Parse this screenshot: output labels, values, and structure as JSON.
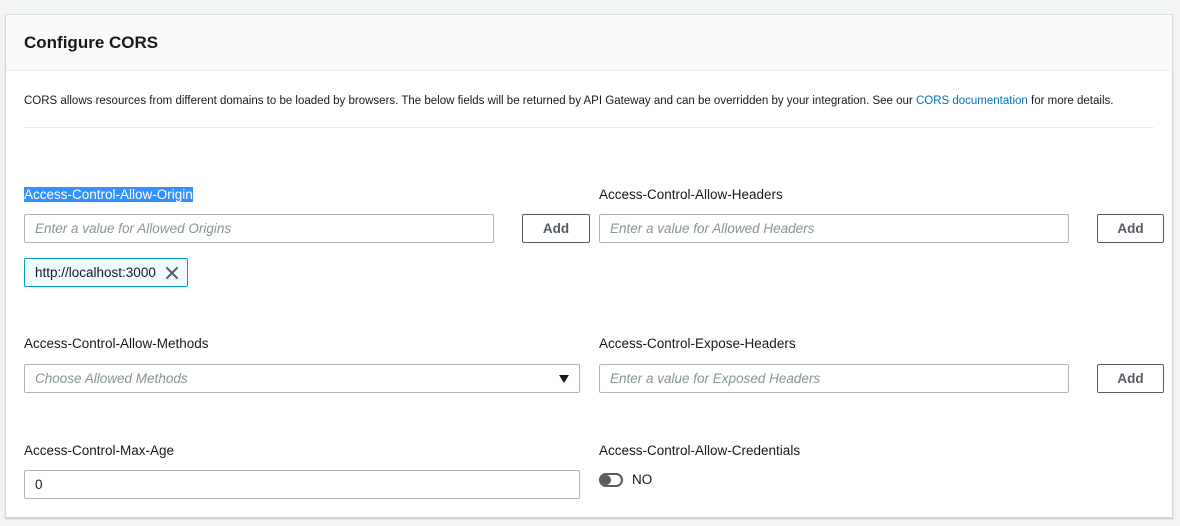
{
  "panel": {
    "title": "Configure CORS",
    "description_before": "CORS allows resources from different domains to be loaded by browsers. The below fields will be returned by API Gateway and can be overridden by your integration. See our ",
    "description_link": "CORS documentation",
    "description_after": " for more details."
  },
  "allow_origin": {
    "label": "Access-Control-Allow-Origin",
    "placeholder": "Enter a value for Allowed Origins",
    "add_label": "Add",
    "tokens": [
      "http://localhost:3000"
    ]
  },
  "allow_headers": {
    "label": "Access-Control-Allow-Headers",
    "placeholder": "Enter a value for Allowed Headers",
    "add_label": "Add"
  },
  "allow_methods": {
    "label": "Access-Control-Allow-Methods",
    "placeholder": "Choose Allowed Methods"
  },
  "expose_headers": {
    "label": "Access-Control-Expose-Headers",
    "placeholder": "Enter a value for Exposed Headers",
    "add_label": "Add"
  },
  "max_age": {
    "label": "Access-Control-Max-Age",
    "value": "0"
  },
  "allow_credentials": {
    "label": "Access-Control-Allow-Credentials",
    "state_label": "NO",
    "enabled": false
  },
  "colors": {
    "link": "#0073bb",
    "token_border": "#00a1c9",
    "selection": "#3390ff"
  }
}
